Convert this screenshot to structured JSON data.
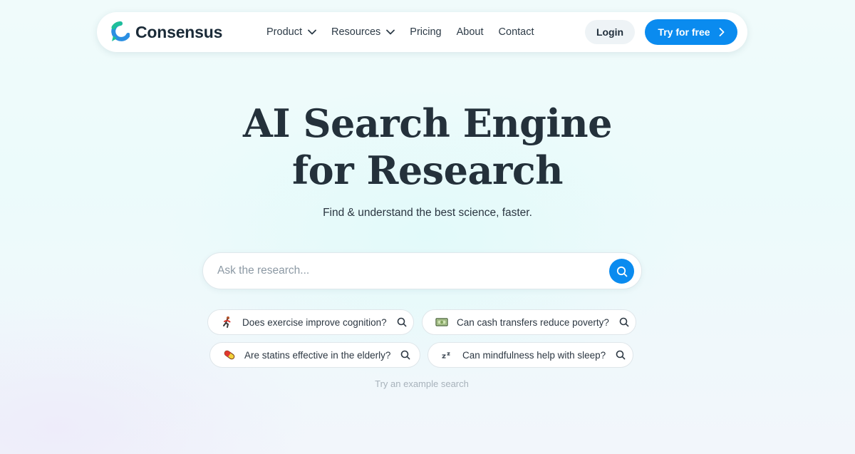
{
  "brand": {
    "name": "Consensus",
    "accent": "#0a8bef",
    "logo_colors": [
      "#1fbf9a",
      "#2a8fe3"
    ]
  },
  "nav": {
    "links": [
      {
        "label": "Product",
        "has_dropdown": true
      },
      {
        "label": "Resources",
        "has_dropdown": true
      },
      {
        "label": "Pricing",
        "has_dropdown": false
      },
      {
        "label": "About",
        "has_dropdown": false
      },
      {
        "label": "Contact",
        "has_dropdown": false
      }
    ],
    "login_label": "Login",
    "cta_label": "Try for free"
  },
  "hero": {
    "title_line1": "AI Search Engine",
    "title_line2": "for Research",
    "subtitle": "Find & understand the best science, faster."
  },
  "search": {
    "placeholder": "Ask the research...",
    "value": ""
  },
  "examples": [
    {
      "icon": "running-person-icon",
      "text": "Does exercise improve cognition?"
    },
    {
      "icon": "money-bill-icon",
      "text": "Can cash transfers reduce poverty?"
    },
    {
      "icon": "pill-icon",
      "text": "Are statins effective in the elderly?"
    },
    {
      "icon": "zzz-icon",
      "text": "Can mindfulness help with sleep?"
    }
  ],
  "hint": "Try an example search"
}
